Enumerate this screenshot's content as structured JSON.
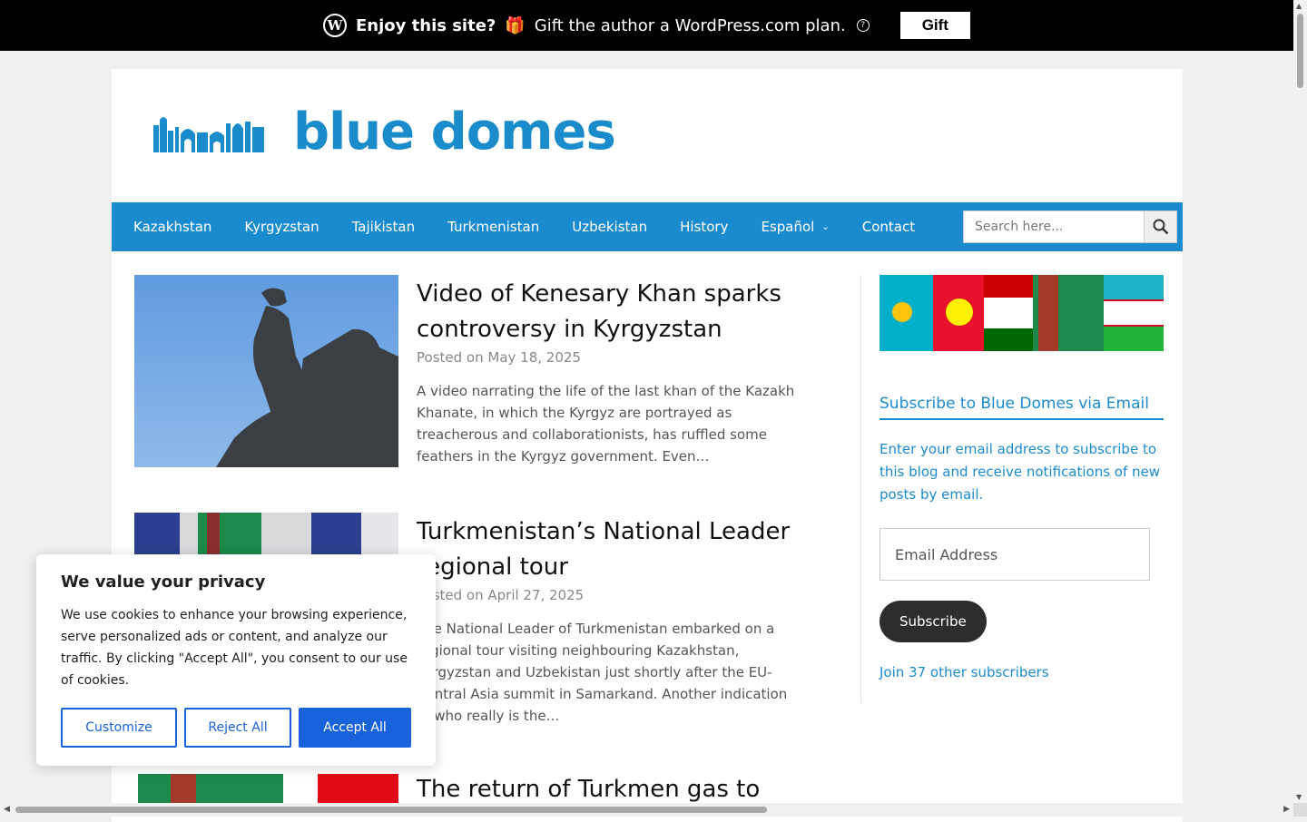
{
  "banner": {
    "enjoy": "Enjoy this site?",
    "gift_emoji": "🎁",
    "message": "Gift the author a WordPress.com plan.",
    "help": "?",
    "gift_button": "Gift"
  },
  "site": {
    "logo_text": "blue domes",
    "brand_color": "#1b8bcf"
  },
  "nav": {
    "items": [
      "Kazakhstan",
      "Kyrgyzstan",
      "Tajikistan",
      "Turkmenistan",
      "Uzbekistan",
      "History",
      "Español",
      "Contact"
    ],
    "dropdown_item": "Español",
    "search_placeholder": "Search here..."
  },
  "posts": [
    {
      "title": "Video of Kenesary Khan sparks controversy in Kyrgyzstan",
      "meta_prefix": "Posted on",
      "date": "May 18, 2025",
      "excerpt": "A video narrating the life of the last khan of the Kazakh Khanate, in which the Kyrgyz are portrayed as treacherous and collaborationists, has ruffled some feathers in the Kyrgyz government. Even…"
    },
    {
      "title": "Turkmenistan’s National Leader regional tour",
      "meta_prefix": "Posted on",
      "date": "April 27, 2025",
      "excerpt": "The National Leader of Turkmenistan embarked on a regional tour visiting neighbouring Kazakhstan, Kyrgyzstan and Uzbekistan just shortly after the EU-Central Asia summit in Samarkand. Another indication of who really is the…"
    },
    {
      "title": "The return of Turkmen gas to"
    }
  ],
  "sidebar": {
    "widget_title": "Subscribe to Blue Domes via Email",
    "description": "Enter your email address to subscribe to this blog and receive notifications of new posts by email.",
    "email_placeholder": "Email Address",
    "subscribe_button": "Subscribe",
    "subscribers_text": "Join 37 other subscribers"
  },
  "cookie": {
    "title": "We value your privacy",
    "text": "We use cookies to enhance your browsing experience, serve personalized ads or content, and analyze our traffic. By clicking \"Accept All\", you consent to our use of cookies.",
    "customize": "Customize",
    "reject": "Reject All",
    "accept": "Accept All"
  }
}
